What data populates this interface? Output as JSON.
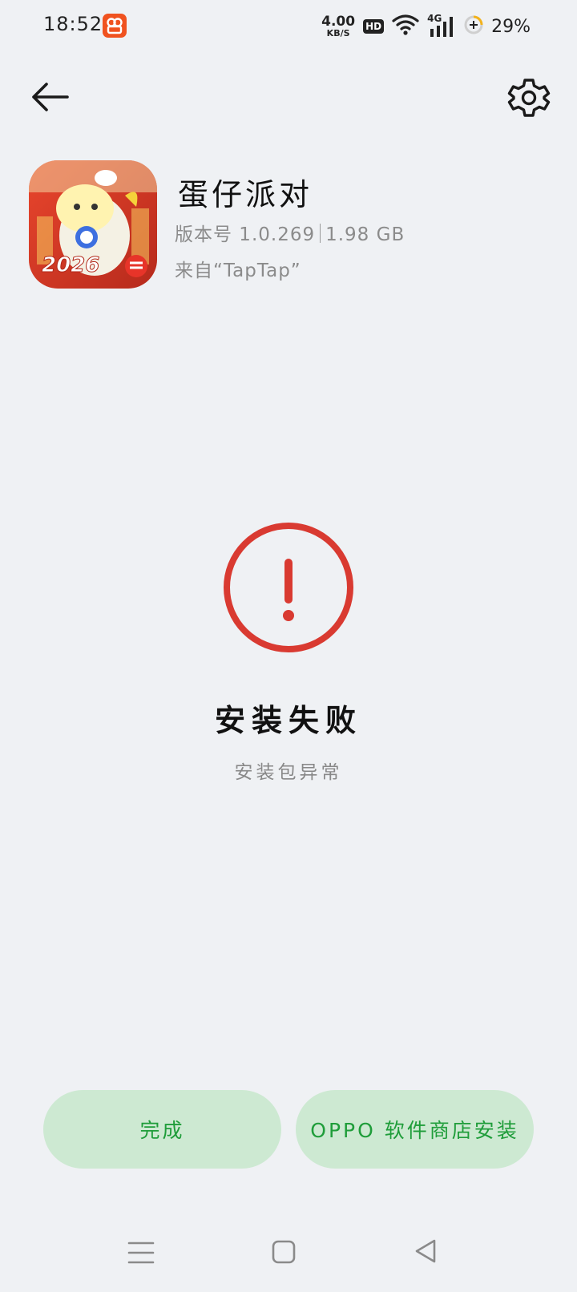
{
  "status_bar": {
    "time": "18:52",
    "net_speed_value": "4.00",
    "net_speed_unit": "KB/S",
    "hd_badge": "HD",
    "signal_label": "4G",
    "battery_percent": "29%"
  },
  "app": {
    "name": "蛋仔派对",
    "version": "版本号 1.0.269",
    "size": "1.98 GB",
    "source": "来自“TapTap”",
    "icon_text": "2026"
  },
  "result": {
    "title": "安装失败",
    "subtitle": "安装包异常",
    "status_color": "#d93a31"
  },
  "buttons": {
    "done_label": "完成",
    "store_label": "OPPO 软件商店安装",
    "accent_color": "#1f9d3a"
  },
  "icons": {
    "back": "back-arrow-icon",
    "settings": "gear-icon",
    "alert": "alert-circle-icon"
  }
}
